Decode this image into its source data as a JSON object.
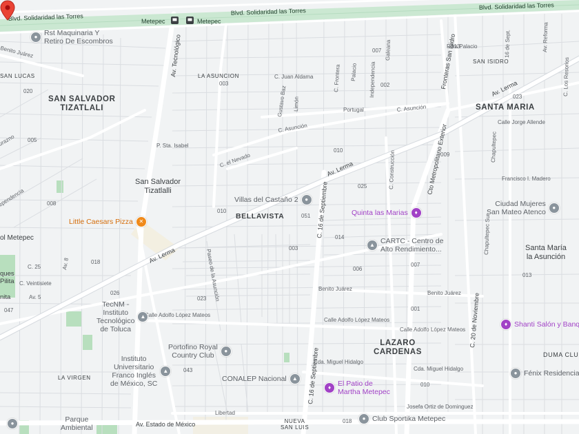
{
  "colors": {
    "background": "#f1f3f4",
    "road_major": "#ffffff",
    "road_minor": "#ffffff",
    "block_lines": "#d8dce0",
    "highway_fill": "#cbe8d2",
    "park_green": "#b8dfbe",
    "poi_gray": "#8a949c",
    "poi_purple": "#a142c6",
    "poi_orange": "#f08a1a",
    "marker_red": "#ea4335"
  },
  "roads": {
    "blvd_left": "Blvd. Solidaridad las Torres",
    "blvd_mid": "Blvd. Solidaridad las Torres",
    "blvd_right": "Blvd. Solidaridad las Torres",
    "metepec_1": "Metepec",
    "metepec_2": "Metepec",
    "av_tecnologico": "Av. Tecnológico",
    "av_lerma_left": "Av. Lerma",
    "av_lerma_mid": "Av. Lerma",
    "av_lerma_right": "Av. Lerma",
    "c_16_sept_1": "C. 16 de Septiembre",
    "c_16_sept_2": "C. 16 de Septiembre",
    "c_20_nov": "C. 20 de Noviembre",
    "fronteras": "Fronteras San Isidro",
    "metropolitano": "Cto Metropolitano Exterior",
    "av_estado": "Av. Estado de México",
    "c_juan_aldama": "C. Juan Aldama",
    "c_asuncion_1": "C. Asunción",
    "c_asuncion_2": "C. Asunción",
    "c_el_nevado": "C. el Nevado",
    "p_sta_isabel": "P. Sta. Isabel",
    "gustavo_baz": "Gustavo Baz",
    "limon": "Limón",
    "c_frontera": "C. Frontera",
    "palacio": "Palacio",
    "galeana": "Galeana",
    "independencia": "Independencia",
    "portugal": "Portugal",
    "riva_palacio": "Riva Palacio",
    "c_16_sept_short": "16 de Sept.",
    "av_reforma": "Av. Reforma",
    "calle_josefa": "Calle Josefa Ortiz de Dominguez",
    "c_los_resorios": "C. Los Resorios",
    "c_construccion": "C. Construcción",
    "calle_leandro": "Calle Leandro",
    "calle_jorge_allende": "Calle Jorge Allende",
    "chapultepec": "Chapultepec",
    "chapultepec_sur": "Chapultepec Sur",
    "francisco_madero": "Francisco I. Madero",
    "paseo_asuncion": "Paseo de la Asunción",
    "benito_juarez_1": "Benito Juárez",
    "benito_juarez_2": "Benito Juárez",
    "calle_adolfo_1": "Calle Adolfo López Mateos",
    "calle_adolfo_2": "Calle Adolfo López Mateos",
    "calle_adolfo_3": "Calle Adolfo López Mateos",
    "cda_miguel_1": "Cda. Miguel Hidalgo",
    "cda_miguel_2": "Cda. Miguel Hidalgo",
    "libertad": "Libertad",
    "josefa_bottom": "Josefa Ortiz de Dominguez",
    "c_ventisiete": "C. Veintisiete",
    "c_25": "C. 25",
    "av_8": "Av. 8",
    "av_5": "Av. 5",
    "benito_juarez_tl": "Benito Juárez",
    "jurazno": "urazno",
    "ependencia": "ependencia"
  },
  "block_numbers": [
    "007",
    "013",
    "002",
    "003",
    "020",
    "005",
    "010",
    "025",
    "009",
    "008",
    "010",
    "051",
    "014",
    "003",
    "006",
    "007",
    "018",
    "026",
    "023",
    "001",
    "047",
    "043",
    "010",
    "018",
    "013",
    "023"
  ],
  "neighborhoods": {
    "san_salvador": [
      "SAN SALVADOR",
      "TIZATLALI"
    ],
    "santa_maria": "SANTA MARIA",
    "bellavista": "BELLAVISTA",
    "lazaro": [
      "LAZARO",
      "CARDENAS"
    ],
    "la_asuncion": "LA ASUNCION",
    "san_isidro": "SAN ISIDRO",
    "san_lucas": "SAN LUCAS",
    "la_virgen": "LA VIRGEN",
    "duma": "DUMA CLUB",
    "nueva_san_luis": [
      "NUEVA",
      "SAN LUIS"
    ]
  },
  "places": {
    "san_salvador_town": [
      "San Salvador",
      "Tizatlalli"
    ],
    "santa_maria_asuncion": [
      "Santa María",
      "la Asunción"
    ],
    "ol_metepec": "ol Metepec",
    "pilita": [
      "ques",
      "Pilita"
    ],
    "nita": "nita",
    "parque": [
      "Parque",
      "Ambiental"
    ]
  },
  "pois": {
    "rst_maquinaria": [
      "Rst Maquinaria Y",
      "Retiro De Escombros"
    ],
    "little_caesars": "Little Caesars Pizza",
    "villas_castano": "Villas del Castaño 2",
    "quinta_marias": "Quinta las Marias",
    "cartc": [
      "CARTC - Centro de",
      "Alto Rendimiento..."
    ],
    "ciudad_mujeres": [
      "Ciudad Mujeres",
      "San Mateo Atenco"
    ],
    "tecnm": [
      "TecNM -",
      "Instituto",
      "Tecnológico",
      "de Toluca"
    ],
    "portofino": [
      "Portofino Royal",
      "Country Club"
    ],
    "instituto_franco": [
      "Instituto",
      "Universitario",
      "Franco Inglés",
      "de México, SC"
    ],
    "conalep": "CONALEP Nacional",
    "patio_martha": [
      "El Patio de",
      "Martha Metepec"
    ],
    "club_sportika": "Club Sportika Metepec",
    "shanti": "Shanti Salón y Banq",
    "fenix": "Fénix Residencial"
  },
  "icons": {
    "place_pin": "place-pin-icon",
    "restaurant": "restaurant-icon",
    "school": "school-icon",
    "event_venue": "event-venue-icon",
    "transit": "transit-icon",
    "location_marker": "location-marker-icon"
  }
}
